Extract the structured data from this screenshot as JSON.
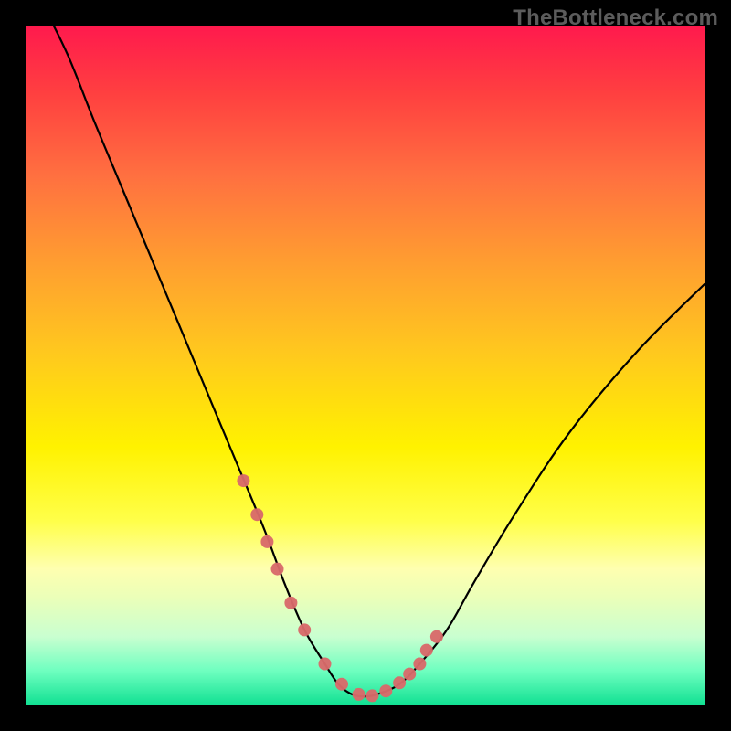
{
  "watermark": "TheBottleneck.com",
  "chart_data": {
    "type": "line",
    "title": "",
    "xlabel": "",
    "ylabel": "",
    "xlim": [
      0,
      100
    ],
    "ylim": [
      0,
      100
    ],
    "series": [
      {
        "name": "curve",
        "x": [
          2,
          6,
          10,
          15,
          20,
          25,
          30,
          35,
          38,
          41,
          44,
          46,
          48,
          50,
          52,
          55,
          58,
          62,
          66,
          72,
          80,
          90,
          100
        ],
        "values": [
          104,
          96,
          86,
          74,
          62,
          50,
          38,
          26,
          18,
          11,
          6,
          3,
          1.5,
          1.2,
          1.6,
          3,
          6,
          11,
          18,
          28,
          40,
          52,
          62
        ]
      }
    ],
    "markers": {
      "name": "dots",
      "x": [
        32,
        34,
        35.5,
        37,
        39,
        41,
        44,
        46.5,
        49,
        51,
        53,
        55,
        56.5,
        58,
        59,
        60.5
      ],
      "values": [
        33,
        28,
        24,
        20,
        15,
        11,
        6,
        3,
        1.5,
        1.3,
        2,
        3.2,
        4.5,
        6,
        8,
        10
      ]
    }
  }
}
